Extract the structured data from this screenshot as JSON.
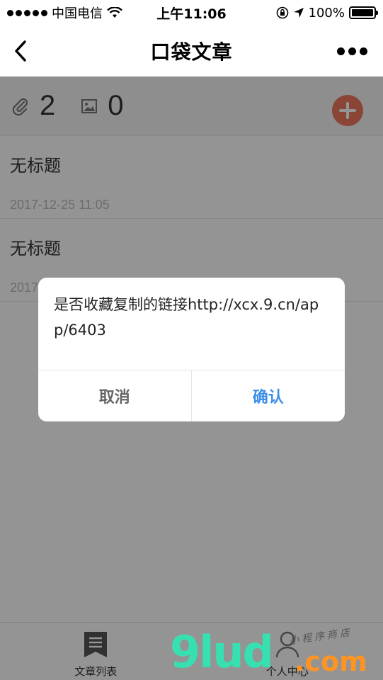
{
  "status_bar": {
    "carrier": "中国电信",
    "time": "上午11:06",
    "battery_percent": "100%",
    "battery_level": 1.0
  },
  "nav": {
    "title": "口袋文章"
  },
  "stats": {
    "attachments_count": "2",
    "images_count": "0"
  },
  "articles": [
    {
      "title": "无标题",
      "date": "2017-12-25 11:05"
    },
    {
      "title": "无标题",
      "date": "2017"
    }
  ],
  "modal": {
    "message": "是否收藏复制的链接http://xcx.9.cn/app/6403",
    "cancel_label": "取消",
    "confirm_label": "确认"
  },
  "tab_bar": {
    "tabs": [
      {
        "label": "文章列表",
        "icon": "bookmark-icon"
      },
      {
        "label": "个人中心",
        "icon": "person-icon"
      }
    ]
  },
  "watermark": {
    "logo": "9lud",
    "suffix": ".com",
    "tagline": "小程序商店"
  },
  "colors": {
    "accent_add": "#f07760",
    "confirm_blue": "#3c8fe6",
    "watermark_green": "#37e0b0",
    "watermark_orange": "#ff9422"
  }
}
